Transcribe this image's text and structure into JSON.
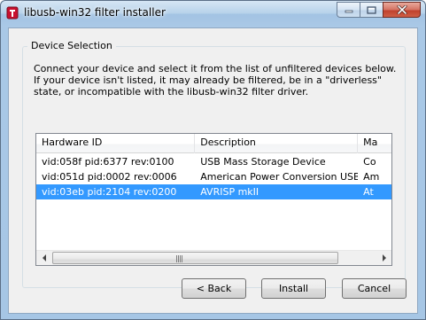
{
  "window": {
    "title": "libusb-win32 filter installer",
    "controls": {
      "minimize_icon": "minimize-icon",
      "maximize_icon": "maximize-icon",
      "close_icon": "close-icon"
    }
  },
  "group": {
    "title": "Device Selection",
    "instructions": "Connect your device and select it from the list of unfiltered devices below. If your device isn't listed, it may already be filtered, be in a \"driverless\" state, or incompatible with the libusb-win32 filter driver."
  },
  "devices": {
    "columns": [
      "Hardware ID",
      "Description",
      "Ma"
    ],
    "rows": [
      {
        "hardware_id": "vid:058f pid:6377 rev:0100",
        "description": "USB Mass Storage Device",
        "manufacturer": "Co"
      },
      {
        "hardware_id": "vid:051d pid:0002 rev:0006",
        "description": "American Power Conversion USB UPS",
        "manufacturer": "Am"
      },
      {
        "hardware_id": "vid:03eb pid:2104 rev:0200",
        "description": "AVRISP mkII",
        "manufacturer": "At",
        "selected": true
      }
    ]
  },
  "buttons": {
    "back": "< Back",
    "install": "Install",
    "cancel": "Cancel"
  },
  "colors": {
    "selection": "#3399ff",
    "close_button": "#c0412d"
  }
}
